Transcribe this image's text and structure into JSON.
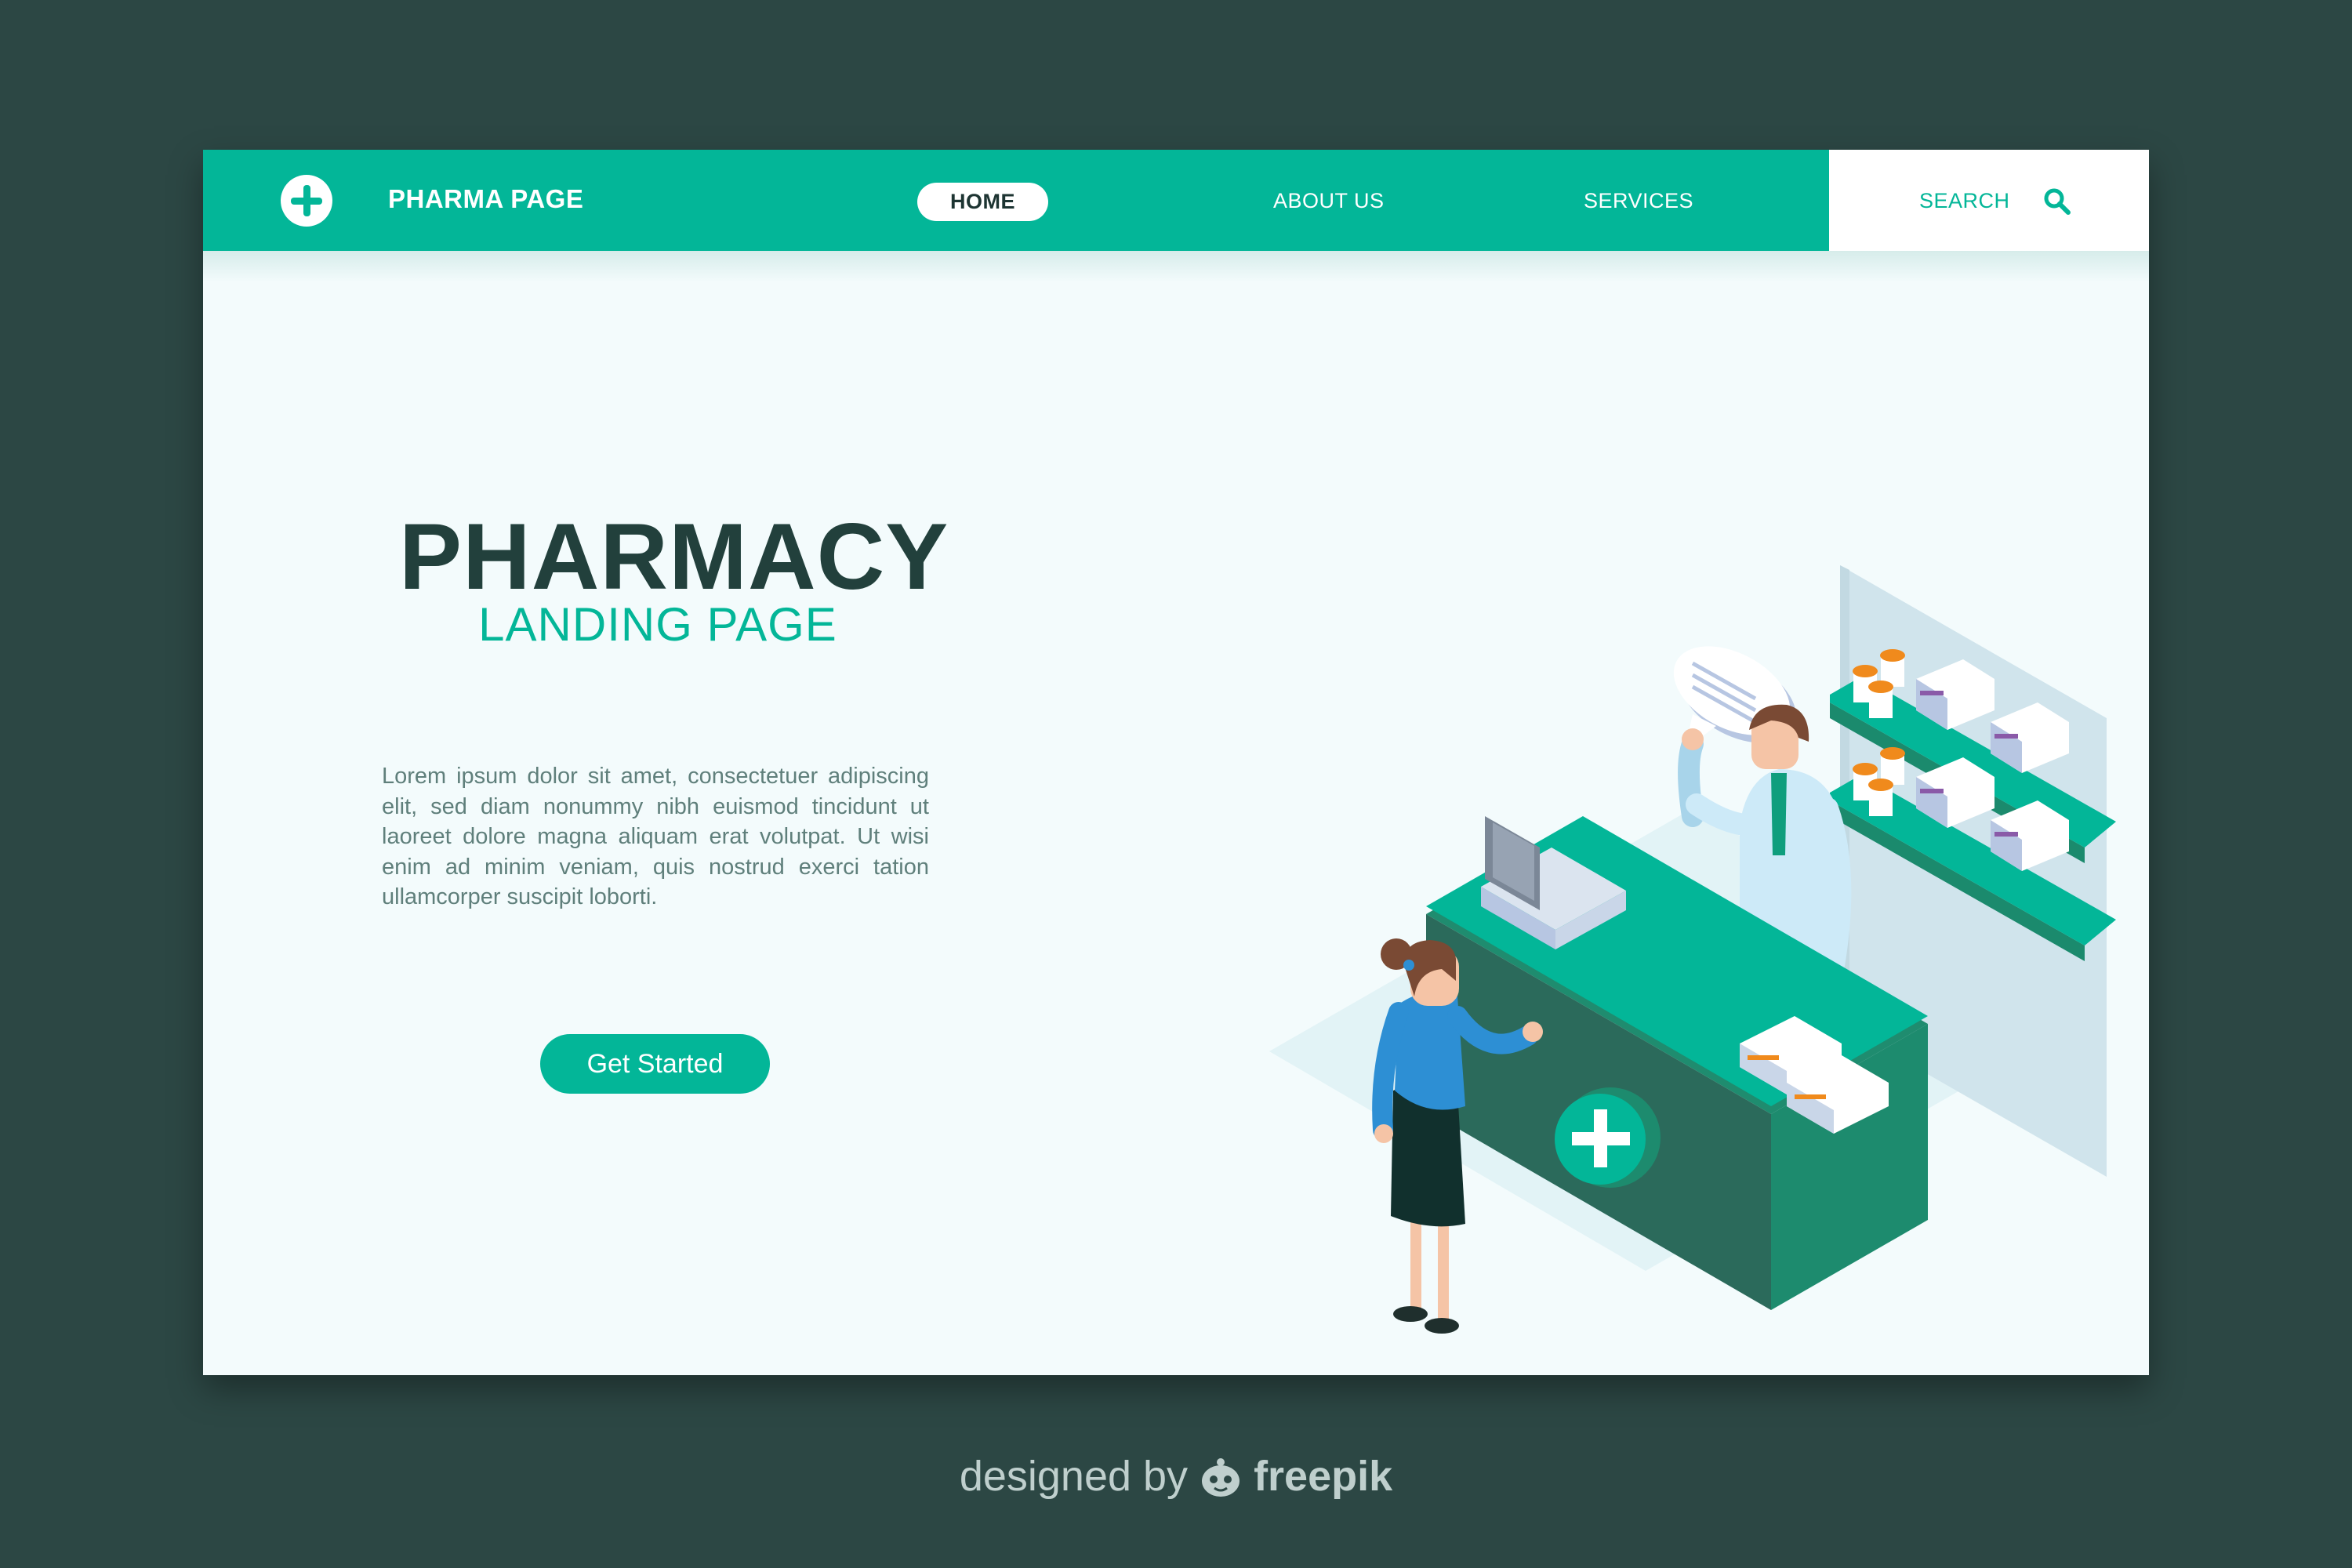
{
  "header": {
    "brand": "PHARMA PAGE",
    "nav": {
      "home": "HOME",
      "about": "ABOUT US",
      "services": "SERVICES"
    },
    "search_label": "SEARCH"
  },
  "hero": {
    "title": "PHARMACY",
    "subtitle": "LANDING PAGE",
    "body": "Lorem ipsum dolor sit amet, consectetuer adipiscing elit, sed diam nonummy nibh euismod tincidunt ut laoreet dolore magna aliquam erat volutpat. Ut wisi enim ad minim veniam, quis nostrud exerci tation ullamcorper suscipit loborti.",
    "cta": "Get Started"
  },
  "credit": {
    "prefix": "designed by",
    "brand": "freepik"
  },
  "colors": {
    "accent": "#03b698",
    "background": "#2c4744",
    "page": "#f3fbfc",
    "title": "#22403c"
  },
  "icons": [
    "plus-icon",
    "search-icon",
    "freepik-logo-icon",
    "medical-cross-icon"
  ]
}
